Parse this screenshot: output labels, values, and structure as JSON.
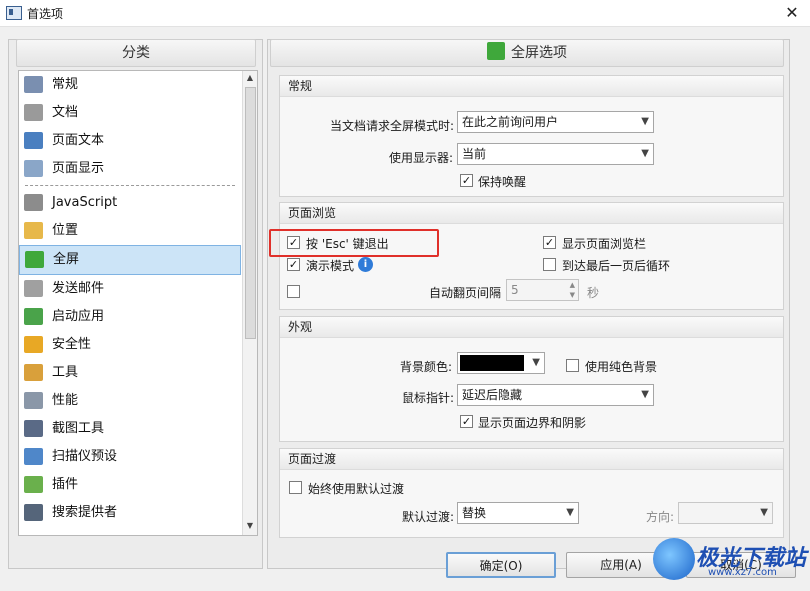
{
  "window": {
    "title": "首选项",
    "close_glyph": "✕"
  },
  "left": {
    "header": "分类",
    "items": [
      {
        "label": "常规",
        "icon": "general-settings-icon",
        "color": "#7a8fb0"
      },
      {
        "label": "文档",
        "icon": "document-icon",
        "color": "#9a9a9a"
      },
      {
        "label": "页面文本",
        "icon": "text-T-icon",
        "color": "#4a7fc0"
      },
      {
        "label": "页面显示",
        "icon": "page-display-icon",
        "color": "#8aa6c8"
      },
      {
        "label": "JavaScript",
        "icon": "javascript-icon",
        "color": "#8c8c8c"
      },
      {
        "label": "位置",
        "icon": "folder-icon",
        "color": "#e7b84a"
      },
      {
        "label": "全屏",
        "icon": "fullscreen-icon",
        "color": "#3fa83b",
        "selected": true
      },
      {
        "label": "发送邮件",
        "icon": "mail-icon",
        "color": "#a0a0a0"
      },
      {
        "label": "启动应用",
        "icon": "app-launch-icon",
        "color": "#4aa34a"
      },
      {
        "label": "安全性",
        "icon": "shield-icon",
        "color": "#e8a825"
      },
      {
        "label": "工具",
        "icon": "tools-icon",
        "color": "#d9a03b"
      },
      {
        "label": "性能",
        "icon": "gauge-icon",
        "color": "#8a97a8"
      },
      {
        "label": "截图工具",
        "icon": "camera-icon",
        "color": "#5a6a86"
      },
      {
        "label": "扫描仪预设",
        "icon": "scanner-icon",
        "color": "#4f87c9"
      },
      {
        "label": "插件",
        "icon": "puzzle-icon",
        "color": "#6ab04c"
      },
      {
        "label": "搜索提供者",
        "icon": "binoculars-icon",
        "color": "#55657a"
      }
    ]
  },
  "right": {
    "header": "全屏选项",
    "general": {
      "title": "常规",
      "request_label": "当文档请求全屏模式时:",
      "request_value": "在此之前询问用户",
      "monitor_label": "使用显示器:",
      "monitor_value": "当前",
      "keep_awake_label": "保持唤醒",
      "keep_awake": true
    },
    "browse": {
      "title": "页面浏览",
      "esc_label": "按 'Esc' 键退出",
      "esc": true,
      "show_bar_label": "显示页面浏览栏",
      "show_bar": true,
      "demo_label": "演示模式",
      "demo": true,
      "loop_label": "到达最后一页后循环",
      "loop": false,
      "auto_label": "自动翻页间隔",
      "auto": false,
      "auto_value": "5",
      "auto_unit": "秒"
    },
    "appearance": {
      "title": "外观",
      "bg_label": "背景颜色:",
      "bg_color": "#000000",
      "solid_label": "使用纯色背景",
      "solid": false,
      "cursor_label": "鼠标指针:",
      "cursor_value": "延迟后隐藏",
      "border_label": "显示页面边界和阴影",
      "border": true
    },
    "transition": {
      "title": "页面过渡",
      "always_label": "始终使用默认过渡",
      "always": false,
      "default_label": "默认过渡:",
      "default_value": "替换",
      "direction_label": "方向:",
      "direction_value": ""
    }
  },
  "buttons": {
    "ok": "确定(O)",
    "apply": "应用(A)",
    "cancel": "取消(C)"
  },
  "watermark": {
    "text": "极光下载站",
    "url": "www.xz7.com"
  },
  "colors": {
    "highlight": "#e0302a",
    "selection": "#cce4f7"
  }
}
